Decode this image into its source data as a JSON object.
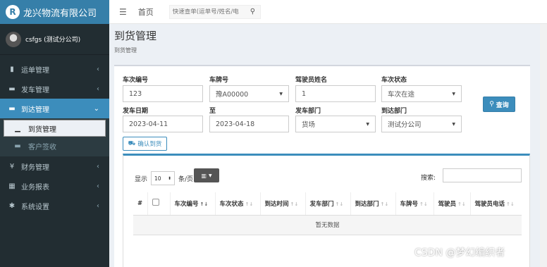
{
  "app": {
    "logo_letter": "R",
    "title": "龙兴物流有限公司"
  },
  "user": {
    "name": "csfgs (测试分公司)"
  },
  "sidebar": {
    "items": [
      {
        "label": "运单管理",
        "icon": "clipboard-icon",
        "glyph": "▮"
      },
      {
        "label": "发车管理",
        "icon": "truck-icon",
        "glyph": "▬"
      },
      {
        "label": "到达管理",
        "icon": "truck-arrive-icon",
        "glyph": "▬"
      }
    ],
    "sub_items": [
      {
        "label": "到货管理",
        "icon": "plane-landing-icon",
        "glyph": "▁"
      },
      {
        "label": "客户签收",
        "icon": "handshake-icon",
        "glyph": "▬"
      }
    ],
    "bottom_items": [
      {
        "label": "财务管理",
        "icon": "yen-icon",
        "glyph": "¥"
      },
      {
        "label": "业务报表",
        "icon": "table-icon",
        "glyph": "▦"
      },
      {
        "label": "系统设置",
        "icon": "gear-icon",
        "glyph": "✱"
      }
    ]
  },
  "topbar": {
    "home": "首页",
    "search_placeholder": "快速查单(运单号/姓名/电"
  },
  "header": {
    "title": "到货管理",
    "breadcrumb": "到货管理"
  },
  "form": {
    "trip_no": {
      "label": "车次编号",
      "value": "123"
    },
    "plate": {
      "label": "车牌号",
      "value": "豫A00000"
    },
    "driver": {
      "label": "驾驶员姓名",
      "value": "1"
    },
    "status": {
      "label": "车次状态",
      "value": "车次在途"
    },
    "depart_date": {
      "label": "发车日期",
      "value": "2023-04-11"
    },
    "to": {
      "label": "至",
      "value": "2023-04-18"
    },
    "depart_dept": {
      "label": "发车部门",
      "value": "货场"
    },
    "arrive_dept": {
      "label": "到达部门",
      "value": "测试分公司"
    },
    "query_button": "查询",
    "confirm_button": "确认到货"
  },
  "table": {
    "show_label": "显示",
    "page_size": "10",
    "per_page": "条/页",
    "search_label": "搜索:",
    "columns": [
      "#",
      "",
      "车次编号",
      "车次状态",
      "到达时间",
      "发车部门",
      "到达部门",
      "车牌号",
      "驾驶员",
      "驾驶员电话"
    ],
    "empty_text": "暂无数据"
  },
  "watermark": "CSDN @梦幻编织者",
  "colors": {
    "primary": "#3c8dbc",
    "sidebar": "#222d32",
    "logo_bar": "#367fa9"
  }
}
